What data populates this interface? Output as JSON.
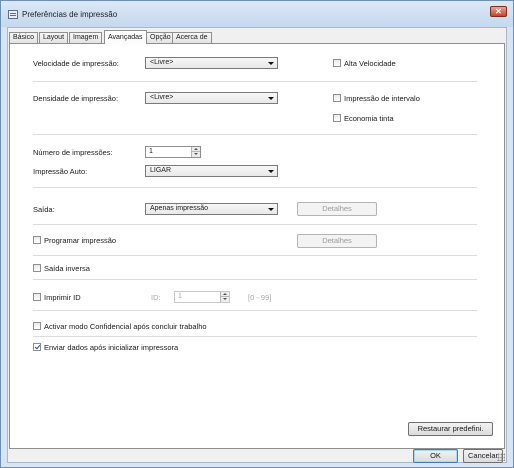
{
  "window": {
    "title": "Preferências de impressão",
    "close_label": "✕"
  },
  "tabs": [
    {
      "label": "Básico"
    },
    {
      "label": "Layout"
    },
    {
      "label": "Imagem"
    },
    {
      "label": "Avançadas",
      "active": true
    },
    {
      "label": "Opção"
    },
    {
      "label": "Acerca de"
    }
  ],
  "speed": {
    "label": "Velocidade de impressão:",
    "value": "<Livre>",
    "high_speed_label": "Alta Velocidade",
    "high_speed_checked": false
  },
  "density": {
    "label": "Densidade de impressão:",
    "value": "<Livre>",
    "interval_label": "Impressão de intervalo",
    "interval_checked": false,
    "eco_label": "Economia tinta",
    "eco_checked": false
  },
  "copies": {
    "label": "Número de impressões:",
    "value": "1"
  },
  "auto_print": {
    "label": "Impressão Auto:",
    "value": "LIGAR"
  },
  "output": {
    "label": "Saída:",
    "value": "Apenas impressão",
    "details_label": "Detalhes"
  },
  "schedule": {
    "label": "Programar impressão",
    "checked": false,
    "details_label": "Detalhes"
  },
  "reverse": {
    "label": "Saída inversa",
    "checked": false
  },
  "print_id": {
    "label": "Imprimir ID",
    "checked": false,
    "id_label": "ID:",
    "id_value": "1",
    "range": "[0 - 99]"
  },
  "confidential": {
    "label": "Activar modo Confidencial após concluir trabalho",
    "checked": false
  },
  "send_data": {
    "label": "Enviar dados após inicializar impressora",
    "checked": true
  },
  "buttons": {
    "restore": "Restaurar predefini.",
    "ok": "OK",
    "cancel": "Cancelar"
  }
}
